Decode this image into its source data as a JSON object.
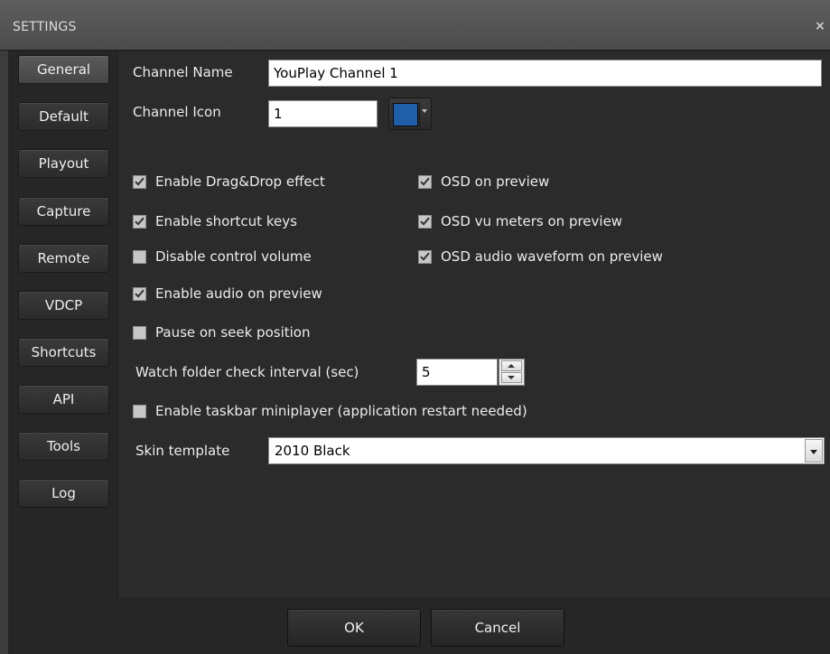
{
  "window": {
    "title": "SETTINGS",
    "close_glyph": "×"
  },
  "sidebar": {
    "items": [
      {
        "label": "General",
        "active": true
      },
      {
        "label": "Default"
      },
      {
        "label": "Playout"
      },
      {
        "label": "Capture"
      },
      {
        "label": "Remote"
      },
      {
        "label": "VDCP"
      },
      {
        "label": "Shortcuts"
      },
      {
        "label": "API"
      },
      {
        "label": "Tools"
      },
      {
        "label": "Log"
      }
    ]
  },
  "general": {
    "channel_name_label": "Channel Name",
    "channel_name_value": "YouPlay Channel 1",
    "channel_icon_label": "Channel Icon",
    "channel_icon_value": "1",
    "channel_icon_color": "#1f5faa",
    "options_left": [
      {
        "label": "Enable Drag&Drop effect",
        "checked": true
      },
      {
        "label": "Enable shortcut keys",
        "checked": true
      },
      {
        "label": "Disable control volume",
        "checked": false
      },
      {
        "label": "Enable audio on preview",
        "checked": true
      },
      {
        "label": "Pause on seek position",
        "checked": false
      }
    ],
    "options_right": [
      {
        "label": "OSD on preview",
        "checked": true
      },
      {
        "label": "OSD vu meters on preview",
        "checked": true
      },
      {
        "label": "OSD audio waveform on preview",
        "checked": true
      }
    ],
    "watch_folder_label": "Watch folder check interval (sec)",
    "watch_folder_value": "5",
    "taskbar_miniplayer": {
      "label": "Enable taskbar miniplayer (application restart needed)",
      "checked": false
    },
    "skin_template_label": "Skin template",
    "skin_template_value": "2010 Black"
  },
  "footer": {
    "ok_label": "OK",
    "cancel_label": "Cancel"
  }
}
